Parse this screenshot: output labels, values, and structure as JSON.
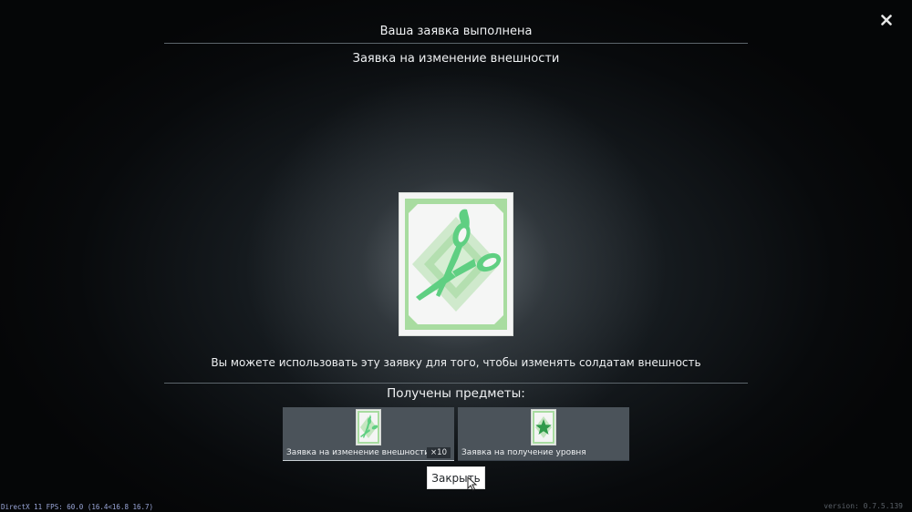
{
  "dialog": {
    "title": "Ваша заявка выполнена",
    "subtitle": "Заявка на изменение внешности",
    "description": "Вы можете использовать эту заявку для того, чтобы изменять солдатам внешность",
    "received_label": "Получены предметы:",
    "close_button_label": "Закрыть",
    "close_icon": "×"
  },
  "card": {
    "icon": "scissors-icon",
    "accent_color": "#5fcf82",
    "frame_color": "#a9dca0"
  },
  "items": [
    {
      "name": "Заявка на изменение внешности",
      "quantity": "×10",
      "icon": "scissors-icon"
    },
    {
      "name": "Заявка на получение уровня",
      "quantity": "",
      "icon": "star-icon"
    }
  ],
  "footer": {
    "fps_text": "DirectX 11 FPS: 60.0 (16.4<16.8 16.7)",
    "version_text": "version: 0.7.5.139"
  }
}
